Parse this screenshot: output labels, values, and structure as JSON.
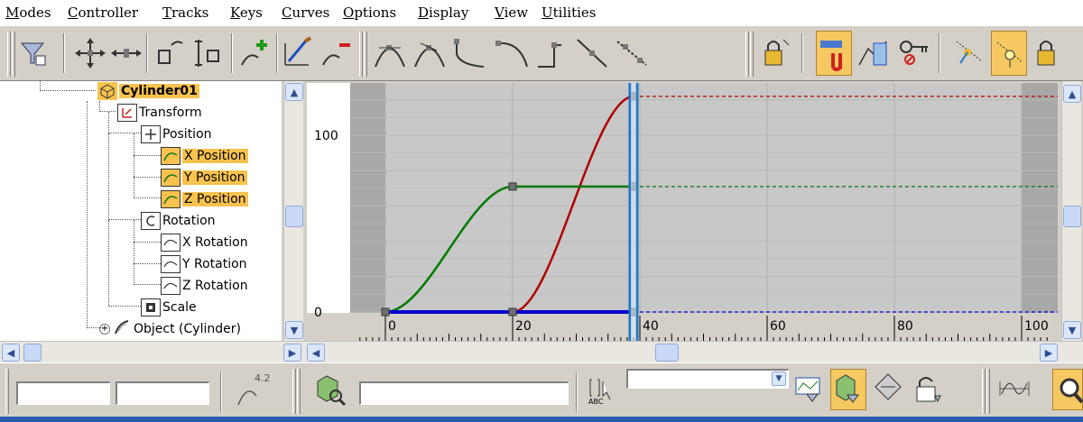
{
  "menu": {
    "items": [
      "Modes",
      "Controller",
      "Tracks",
      "Keys",
      "Curves",
      "Options",
      "Display",
      "View",
      "Utilities"
    ]
  },
  "toolbar": {
    "buttons": [
      "filters",
      "move-keys",
      "slide-keys",
      "scale-keys",
      "scale-values",
      "add-keys",
      "draw-curves",
      "reduce-keys",
      "set-tangents-auto",
      "set-tangents-custom",
      "set-tangents-fast",
      "set-tangents-slow",
      "set-tangents-step",
      "set-tangents-linear",
      "set-tangents-smooth",
      "lock-selection",
      "snap-frames",
      "show-keyable",
      "parameter-curve-out-of-range",
      "show-biped-position",
      "show-biped-rotation",
      "show-biped-xyz"
    ],
    "active": [
      "snap-frames",
      "show-biped-rotation"
    ]
  },
  "tree": {
    "nodes": [
      {
        "label": "Cylinder01",
        "icon": "object-icon",
        "bold": true,
        "selected": false
      },
      {
        "label": "Transform",
        "icon": "transform-icon",
        "selected": false
      },
      {
        "label": "Position",
        "icon": "position-icon",
        "selected": false
      },
      {
        "label": "X Position",
        "icon": "curve-icon",
        "selected": true
      },
      {
        "label": "Y Position",
        "icon": "curve-icon",
        "selected": true
      },
      {
        "label": "Z Position",
        "icon": "curve-icon",
        "selected": true
      },
      {
        "label": "Rotation",
        "icon": "rotation-icon",
        "selected": false
      },
      {
        "label": "X Rotation",
        "icon": "curve-icon",
        "selected": false
      },
      {
        "label": "Y Rotation",
        "icon": "curve-icon",
        "selected": false
      },
      {
        "label": "Z Rotation",
        "icon": "curve-icon",
        "selected": false
      },
      {
        "label": "Scale",
        "icon": "scale-icon",
        "selected": false
      },
      {
        "label": "Object (Cylinder)",
        "icon": "modifier-icon",
        "selected": false
      }
    ]
  },
  "graph": {
    "y_labels": [
      "100",
      "0"
    ],
    "x_labels": [
      "0",
      "20",
      "40",
      "60",
      "80",
      "100"
    ],
    "current_frame": 39,
    "curves": [
      {
        "name": "X Position",
        "color": "#b00000",
        "keys": [
          [
            0,
            0
          ],
          [
            20,
            0
          ],
          [
            39,
            122
          ]
        ]
      },
      {
        "name": "Y Position",
        "color": "#007a00",
        "keys": [
          [
            0,
            0
          ],
          [
            20,
            71
          ],
          [
            39,
            71
          ]
        ]
      },
      {
        "name": "Z Position",
        "color": "#0000d0",
        "keys": [
          [
            0,
            0
          ],
          [
            20,
            0
          ],
          [
            39,
            0
          ]
        ]
      }
    ],
    "x_range": [
      -5,
      105
    ],
    "y_range": [
      0,
      140
    ]
  },
  "status": {
    "abc_label": "ABC",
    "coord_icon": "4.2",
    "frame_field": "",
    "value_field": "",
    "key_name_field": "",
    "filter_dropdown": ""
  },
  "colors": {
    "accent": "#f5c862",
    "graph_bg": "#c8c8c8",
    "time_line": "#1e78c8"
  }
}
